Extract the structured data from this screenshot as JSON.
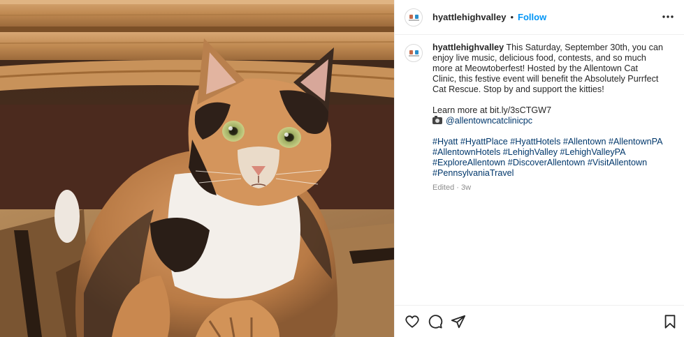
{
  "post": {
    "username": "hyattlehighvalley",
    "separator": "•",
    "follow_label": "Follow",
    "caption": {
      "text_1": "This Saturday, September 30th, you can enjoy live music, delicious food, contests, and so much more at Meowtoberfest! Hosted by the Allentown Cat Clinic, this festive event will benefit the Absolutely Purrfect Cat Rescue. Stop by and support the kitties!",
      "learn_more": "Learn more at bit.ly/3sCTGW7",
      "mention": "@allentowncatclinicpc",
      "hashtags_line1": "#Hyatt #HyattPlace #HyattHotels #Allentown #AllentownPA",
      "hashtags_line2": "#AllentownHotels #LehighValley #LehighValleyPA",
      "hashtags_line3": "#ExploreAllentown #DiscoverAllentown #VisitAllentown",
      "hashtags_line4": "#PennsylvaniaTravel"
    },
    "meta": "Edited · 3w"
  },
  "icons": {
    "more": "more-horizontal-icon",
    "like": "heart-icon",
    "comment": "comment-icon",
    "share": "share-icon",
    "save": "bookmark-icon",
    "camera": "camera-emoji-icon"
  },
  "colors": {
    "follow": "#0095f6",
    "link": "#00376b",
    "meta": "#8e8e8e",
    "text": "#262626"
  }
}
